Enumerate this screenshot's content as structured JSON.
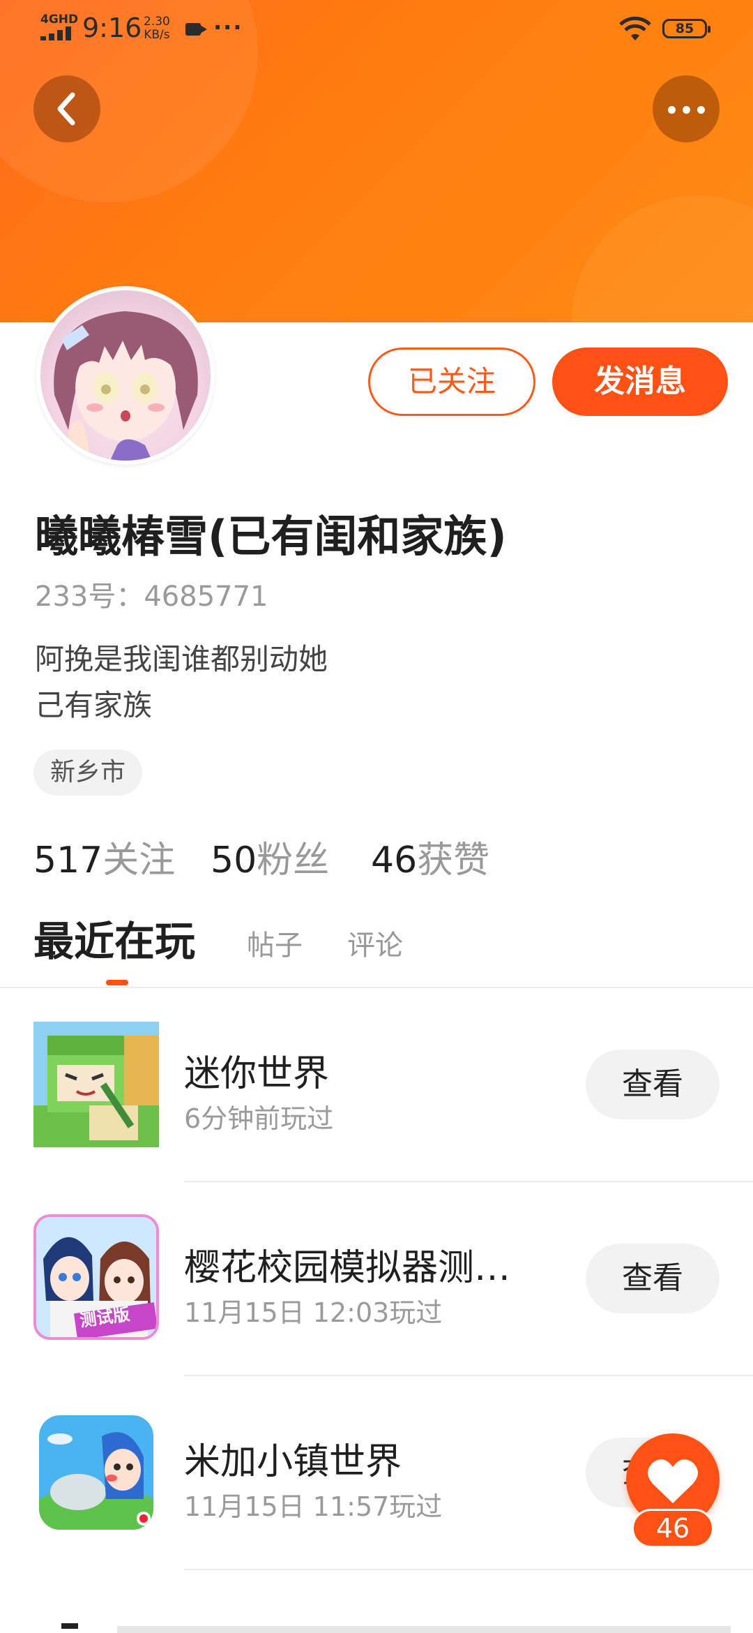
{
  "status_bar": {
    "network": "4GHD",
    "time": "9:16",
    "speed_value": "2.30",
    "speed_unit": "KB/s",
    "overflow": "···",
    "battery": "85"
  },
  "profile": {
    "name": "曦曦椿雪(已有闺和家族)",
    "uid": "233号：4685771",
    "bio_line1": "阿挽是我闺谁都别动她",
    "bio_line2": "己有家族",
    "location": "新乡市",
    "follow_button": "已关注",
    "message_button": "发消息",
    "stats": {
      "following_count": "517",
      "following_label": "关注",
      "fans_count": "50",
      "fans_label": "粉丝",
      "likes_count": "46",
      "likes_label": "获赞"
    }
  },
  "tabs": [
    {
      "label": "最近在玩",
      "active": true
    },
    {
      "label": "帖子",
      "active": false
    },
    {
      "label": "评论",
      "active": false
    }
  ],
  "games": [
    {
      "name": "迷你世界",
      "played": "6分钟前玩过",
      "action": "查看"
    },
    {
      "name": "樱花校园模拟器测…",
      "played": "11月15日 12:03玩过",
      "action": "查看"
    },
    {
      "name": "米加小镇世界",
      "played": "11月15日 11:57玩过",
      "action": "查看"
    }
  ],
  "game_badges": {
    "sakura": "测试版"
  },
  "like_fab": {
    "count": "46"
  },
  "colors": {
    "accent": "#ff5113",
    "header": "#ff7a12"
  }
}
